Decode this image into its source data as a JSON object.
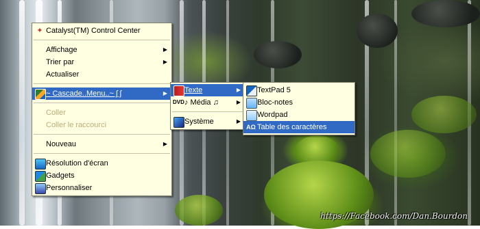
{
  "desktop": {
    "watermark": "https://Facebook.com/Dan.Bourdon"
  },
  "context_menu": {
    "items": [
      {
        "label": "Catalyst(TM) Control Center",
        "icon": "catalyst-icon"
      },
      {
        "label": "Affichage",
        "submenu": true
      },
      {
        "label": "Trier par",
        "submenu": true
      },
      {
        "label": "Actualiser"
      },
      {
        "label": "⁠ᴛ≈ Cascade…Menu…♫∫ƒ",
        "display": "~ Cascade..Menu..~ ʃ ʃ",
        "submenu": true,
        "highlighted": true,
        "icon": "cascade-menu-icon"
      },
      {
        "label": "Coller",
        "disabled": true
      },
      {
        "label": "Coller le raccourci",
        "disabled": true
      },
      {
        "label": "Nouveau",
        "submenu": true
      },
      {
        "label": "Résolution d'écran",
        "icon": "screen-resolution-icon"
      },
      {
        "label": "Gadgets",
        "icon": "gadgets-icon"
      },
      {
        "label": "Personnaliser",
        "icon": "personalize-icon"
      }
    ]
  },
  "submenu_1": {
    "items": [
      {
        "label": "Texte",
        "submenu": true,
        "highlighted": true,
        "icon": "text-book-icon"
      },
      {
        "label": "♪ Média ♫",
        "submenu": true,
        "icon": "dvd-icon"
      },
      {
        "label": "Système",
        "submenu": true,
        "icon": "system-icon"
      }
    ]
  },
  "submenu_2": {
    "items": [
      {
        "label": "TextPad 5",
        "icon": "textpad-icon"
      },
      {
        "label": "Bloc-notes",
        "icon": "notepad-icon"
      },
      {
        "label": "Wordpad",
        "icon": "wordpad-icon"
      },
      {
        "label": "Table des caractères",
        "highlighted": true,
        "icon": "character-map-icon"
      }
    ]
  },
  "colors": {
    "menu_background": "#ffffe1",
    "highlight": "#316ac5",
    "disabled_text": "#b9ac78"
  },
  "arrow_glyph": "▶"
}
